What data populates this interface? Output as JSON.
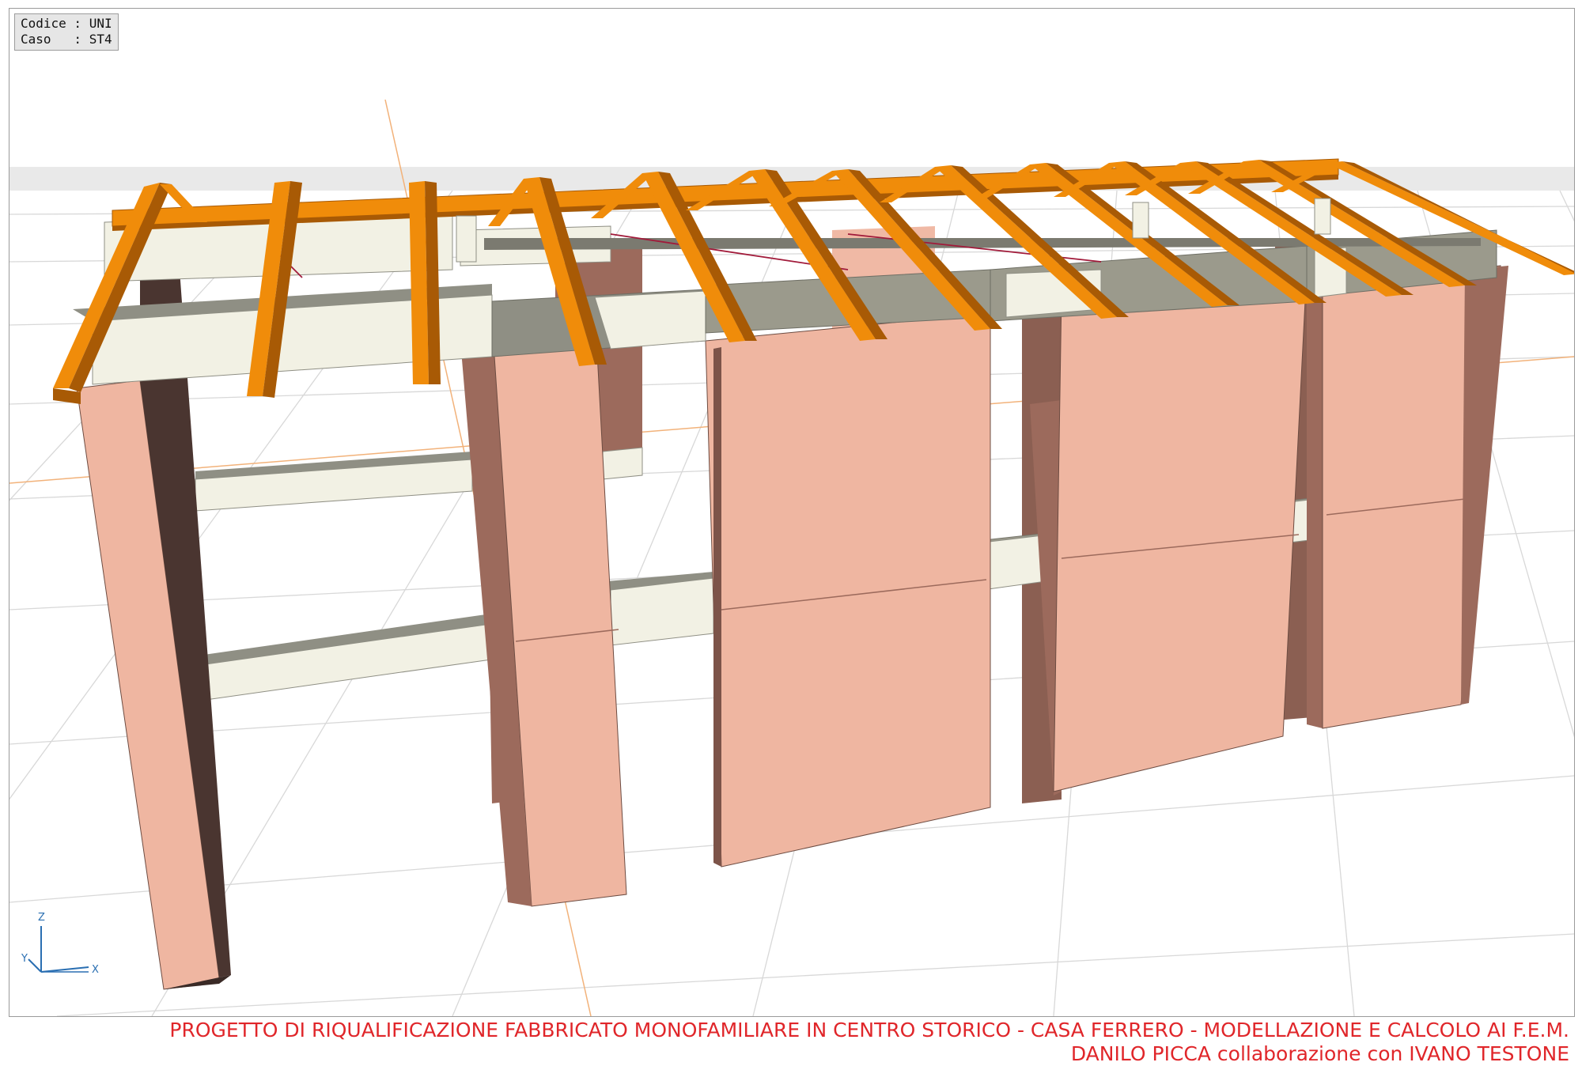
{
  "info": {
    "codice_label": "Codice",
    "codice_value": "UNI",
    "caso_label": "Caso",
    "caso_value": "ST4"
  },
  "axes": {
    "x_label": "X",
    "y_label": "Y",
    "z_label": "Z"
  },
  "footer": {
    "title": "PROGETTO DI RIQUALIFICAZIONE FABBRICATO MONOFAMILIARE IN CENTRO STORICO - CASA FERRERO - MODELLAZIONE E CALCOLO AI F.E.M.",
    "credits": "DANILO PICCA collaborazione con IVANO TESTONE"
  },
  "colors": {
    "wall": "#efb6a1",
    "wall_dark": "#9c6a5c",
    "beam": "#f2f1e4",
    "beam_shadow": "#8f8f84",
    "timber": "#f08c0a",
    "timber_dark": "#a85a05",
    "grid": "#d4d4d4",
    "footer_text": "#e0262a"
  }
}
